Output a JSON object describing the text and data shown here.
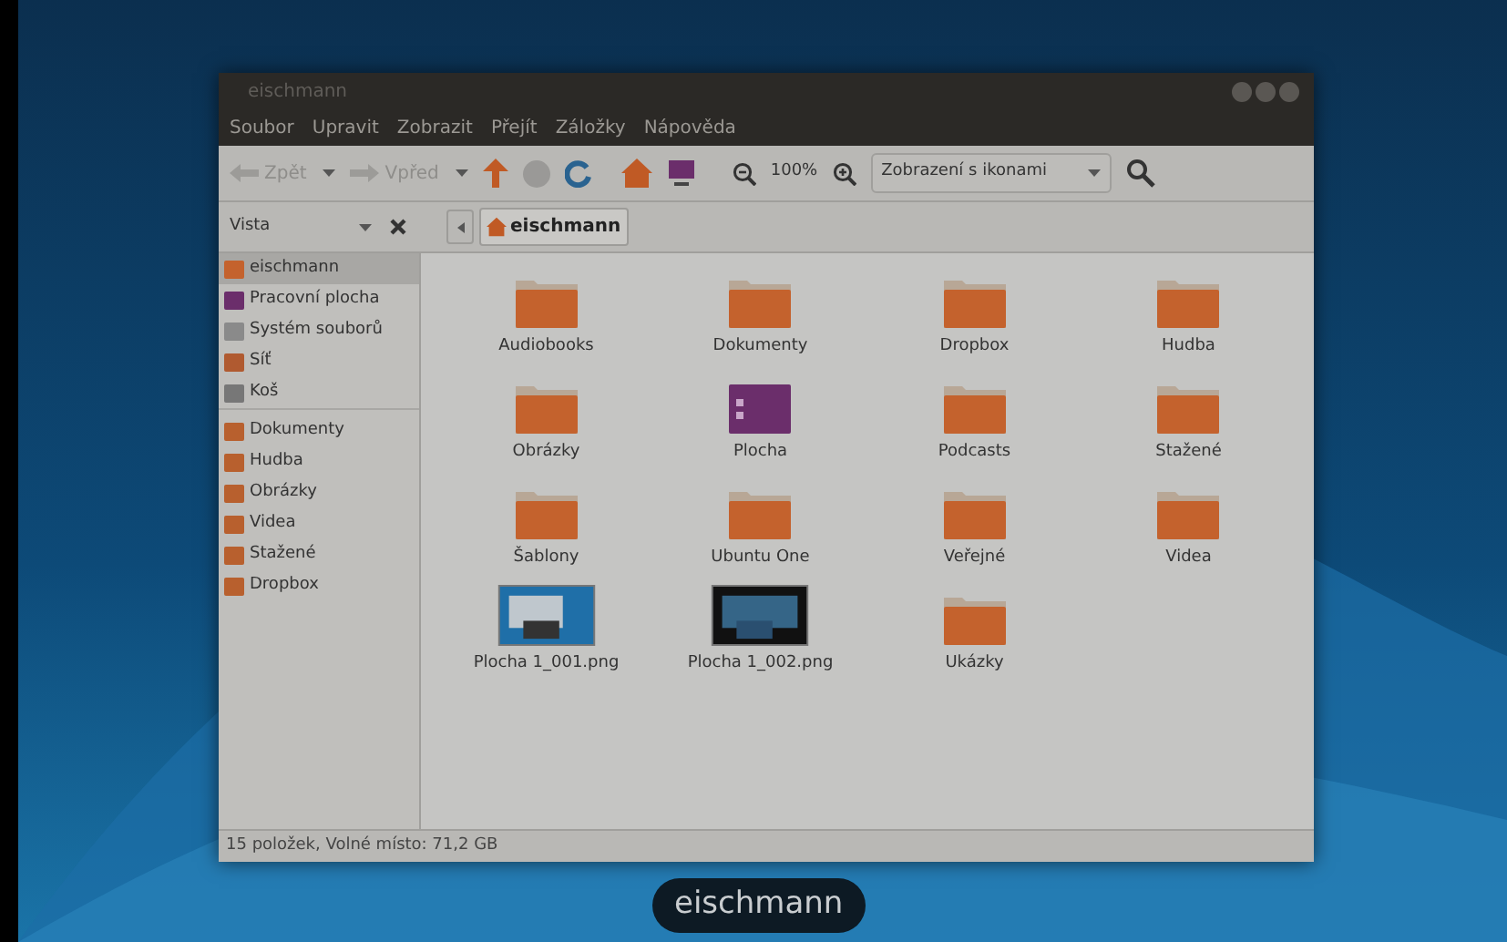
{
  "window": {
    "title": "eischmann"
  },
  "menu": [
    "Soubor",
    "Upravit",
    "Zobrazit",
    "Přejít",
    "Záložky",
    "Nápověda"
  ],
  "toolbar": {
    "back": {
      "label": "Zpět",
      "disabled": true
    },
    "forward": {
      "label": "Vpřed",
      "disabled": true
    },
    "stop": {
      "disabled": true
    },
    "zoom": "100%",
    "view_mode": "Zobrazení s ikonami"
  },
  "location_bar": {
    "sidebar_mode": "Vista",
    "path": [
      {
        "label": "eischmann",
        "selected": true
      }
    ]
  },
  "sidebar": {
    "groups": [
      {
        "items": [
          {
            "label": "eischmann",
            "selected": true
          },
          {
            "label": "Pracovní plocha",
            "selected": false
          },
          {
            "label": "Systém souborů",
            "selected": false
          },
          {
            "label": "Síť",
            "selected": false
          },
          {
            "label": "Koš",
            "selected": false
          }
        ]
      },
      {
        "items": [
          {
            "label": "Dokumenty",
            "selected": false
          },
          {
            "label": "Hudba",
            "selected": false
          },
          {
            "label": "Obrázky",
            "selected": false
          },
          {
            "label": "Videa",
            "selected": false
          },
          {
            "label": "Stažené",
            "selected": false
          },
          {
            "label": "Dropbox",
            "selected": false
          }
        ]
      }
    ]
  },
  "files": [
    {
      "name": "Audiobooks",
      "kind": "folder"
    },
    {
      "name": "Dokumenty",
      "kind": "folder"
    },
    {
      "name": "Dropbox",
      "kind": "folder"
    },
    {
      "name": "Hudba",
      "kind": "folder"
    },
    {
      "name": "Obrázky",
      "kind": "folder"
    },
    {
      "name": "Plocha",
      "kind": "desktop"
    },
    {
      "name": "Podcasts",
      "kind": "folder"
    },
    {
      "name": "Stažené",
      "kind": "folder"
    },
    {
      "name": "Šablony",
      "kind": "folder"
    },
    {
      "name": "Ubuntu One",
      "kind": "folder"
    },
    {
      "name": "Veřejné",
      "kind": "folder"
    },
    {
      "name": "Videa",
      "kind": "folder"
    },
    {
      "name": "Plocha 1_001.png",
      "kind": "image"
    },
    {
      "name": "Plocha 1_002.png",
      "kind": "screenshot"
    },
    {
      "name": "Ukázky",
      "kind": "folder"
    }
  ],
  "status_bar": "15 položek, Volné místo: 71,2 GB",
  "switcher_label": "eischmann"
}
